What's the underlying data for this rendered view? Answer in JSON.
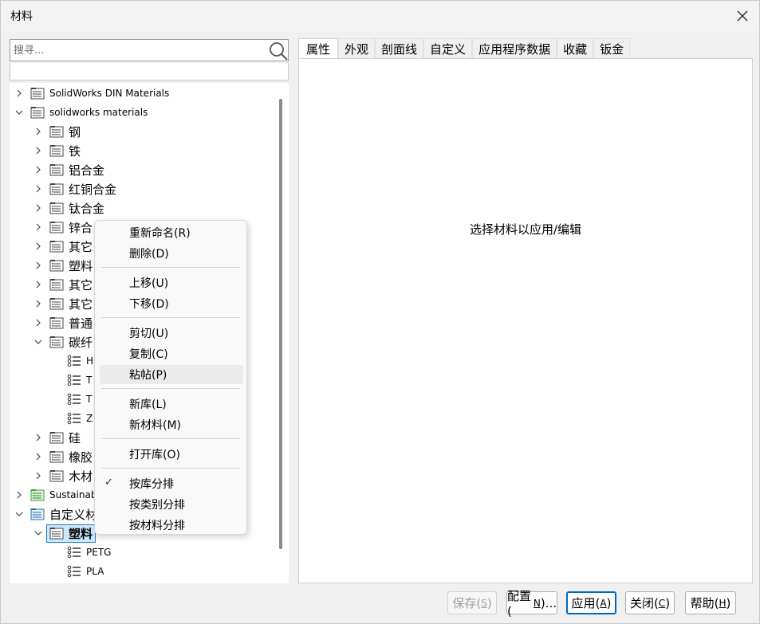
{
  "window": {
    "title": "材料",
    "close_icon": "close-icon"
  },
  "search": {
    "placeholder": "搜寻...",
    "value": ""
  },
  "tree": {
    "items": [
      {
        "label": "SolidWorks DIN Materials",
        "expanded": false,
        "icon": "library-icon"
      },
      {
        "label": "solidworks materials",
        "expanded": true,
        "icon": "library-icon"
      },
      {
        "label": "钢",
        "expanded": false,
        "icon": "category-folder-icon"
      },
      {
        "label": "铁",
        "expanded": false,
        "icon": "category-folder-icon"
      },
      {
        "label": "铝合金",
        "expanded": false,
        "icon": "category-folder-icon"
      },
      {
        "label": "红铜合金",
        "expanded": false,
        "icon": "category-folder-icon"
      },
      {
        "label": "钛合金",
        "expanded": false,
        "icon": "category-folder-icon"
      },
      {
        "label": "锌合",
        "expanded": false,
        "icon": "category-folder-icon"
      },
      {
        "label": "其它",
        "expanded": false,
        "icon": "category-folder-icon"
      },
      {
        "label": "塑料",
        "expanded": false,
        "icon": "category-folder-icon"
      },
      {
        "label": "其它",
        "expanded": false,
        "icon": "category-folder-icon"
      },
      {
        "label": "其它",
        "expanded": false,
        "icon": "category-folder-icon"
      },
      {
        "label": "普通",
        "expanded": false,
        "icon": "category-folder-icon"
      },
      {
        "label": "碳纤",
        "expanded": true,
        "icon": "category-folder-icon"
      },
      {
        "label": "H",
        "icon": "material-list-icon"
      },
      {
        "label": "T",
        "icon": "material-list-icon"
      },
      {
        "label": "T",
        "icon": "material-list-icon"
      },
      {
        "label": "Z",
        "icon": "material-list-icon"
      },
      {
        "label": "硅",
        "expanded": false,
        "icon": "category-folder-icon"
      },
      {
        "label": "橡胶",
        "expanded": false,
        "icon": "category-folder-icon"
      },
      {
        "label": "木材",
        "expanded": false,
        "icon": "category-folder-icon"
      },
      {
        "label": "Sustainab",
        "expanded": false,
        "icon": "green-library-icon"
      },
      {
        "label": "自定义材",
        "expanded": true,
        "icon": "custom-library-icon"
      },
      {
        "label": "塑料",
        "expanded": true,
        "icon": "category-folder-icon",
        "selected": true
      },
      {
        "label": "PETG",
        "icon": "material-list-icon"
      },
      {
        "label": "PLA",
        "icon": "material-list-icon"
      }
    ]
  },
  "tabs": [
    {
      "label": "属性",
      "active": true
    },
    {
      "label": "外观"
    },
    {
      "label": "剖面线"
    },
    {
      "label": "自定义"
    },
    {
      "label": "应用程序数据"
    },
    {
      "label": "收藏"
    },
    {
      "label": "钣金"
    }
  ],
  "content": {
    "prompt": "选择材料以应用/编辑"
  },
  "buttons": {
    "save": {
      "label": "保存(",
      "key": "S",
      "tail": ")"
    },
    "config": {
      "label": "配置(",
      "key": "N",
      "tail": ")..."
    },
    "apply": {
      "label": "应用(",
      "key": "A",
      "tail": ")"
    },
    "close": {
      "label": "关闭(",
      "key": "C",
      "tail": ")"
    },
    "help": {
      "label": "帮助(",
      "key": "H",
      "tail": ")"
    }
  },
  "context_menu": {
    "items": {
      "rename": "重新命名(R)",
      "delete": "删除(D)",
      "move_up": "上移(U)",
      "move_down": "下移(D)",
      "cut": "剪切(U)",
      "copy": "复制(C)",
      "paste": "粘帖(P)",
      "new_library": "新库(L)",
      "new_material": "新材料(M)",
      "open_library": "打开库(O)",
      "sort_by_library": "按库分排",
      "sort_by_category": "按类别分排",
      "sort_by_material": "按材料分排"
    },
    "checked_item": "sort_by_library",
    "hovered_item": "paste"
  },
  "colors": {
    "selection_bg": "#cce8ff",
    "selection_border": "#1e75c9",
    "primary_button_border": "#0067c0",
    "library_icon_green": "#3aa23a"
  }
}
